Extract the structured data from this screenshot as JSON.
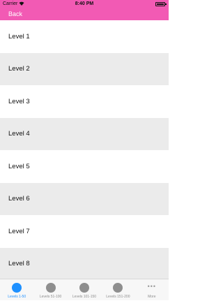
{
  "status_bar": {
    "carrier": "Carrier",
    "wifi_icon": "wifi-icon",
    "time": "8:40 PM",
    "battery_icon": "battery-icon"
  },
  "nav": {
    "back_label": "Back",
    "background_color": "#f25ab4"
  },
  "levels": [
    {
      "label": "Level 1"
    },
    {
      "label": "Level 2"
    },
    {
      "label": "Level 3"
    },
    {
      "label": "Level 4"
    },
    {
      "label": "Level 5"
    },
    {
      "label": "Level 6"
    },
    {
      "label": "Level 7"
    },
    {
      "label": "Level 8"
    }
  ],
  "tabs": [
    {
      "label": "Levels 1-50",
      "active": true,
      "icon": "circle-icon"
    },
    {
      "label": "Levels 51-100",
      "active": false,
      "icon": "circle-icon"
    },
    {
      "label": "Levels 101-150",
      "active": false,
      "icon": "circle-icon"
    },
    {
      "label": "Levels 151-200",
      "active": false,
      "icon": "circle-icon"
    },
    {
      "label": "More",
      "active": false,
      "icon": "more-icon",
      "glyph": "•••"
    }
  ],
  "colors": {
    "accent": "#1e90ff",
    "row_alt": "#ebebeb"
  }
}
